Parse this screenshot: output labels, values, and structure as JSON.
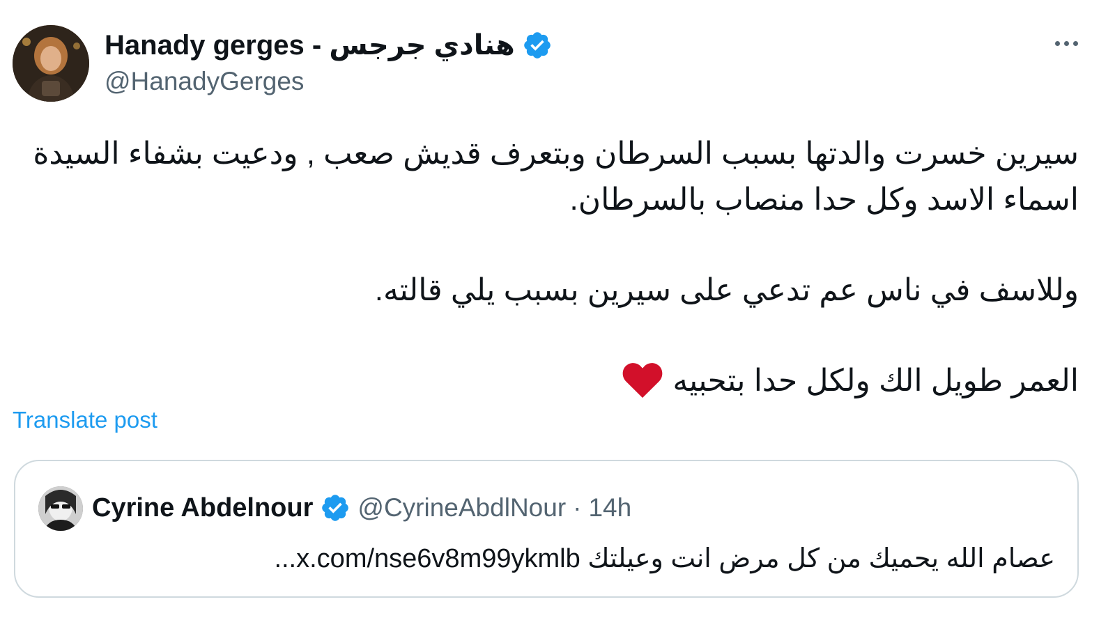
{
  "post": {
    "author_name": "هنادي جرجس - Hanady gerges",
    "author_handle": "@HanadyGerges",
    "verified": true,
    "paragraphs": [
      "سيرين خسرت والدتها بسبب السرطان وبتعرف قديش صعب , ودعيت بشفاء السيدة اسماء الاسد وكل حدا منصاب بالسرطان.",
      "وللاسف في ناس عم تدعي على سيرين بسبب يلي قالته.",
      "العمر طويل الك ولكل حدا بتحبيه"
    ],
    "emoji": "red-heart",
    "translate_label": "Translate post",
    "more_icon": "more-horizontal-icon"
  },
  "quote": {
    "author_name": "Cyrine Abdelnour",
    "author_handle": "@CyrineAbdlNour",
    "separator": "·",
    "time": "14h",
    "verified": true,
    "text": "عصام الله يحميك من كل مرض انت وعيلتك x.com/nse6v8m99ykmlb..."
  },
  "colors": {
    "verified_blue": "#1d9bf0",
    "link_blue": "#1d9bf0",
    "secondary_text": "#536471",
    "heart_red": "#d2102a",
    "border": "#cfd9de"
  }
}
